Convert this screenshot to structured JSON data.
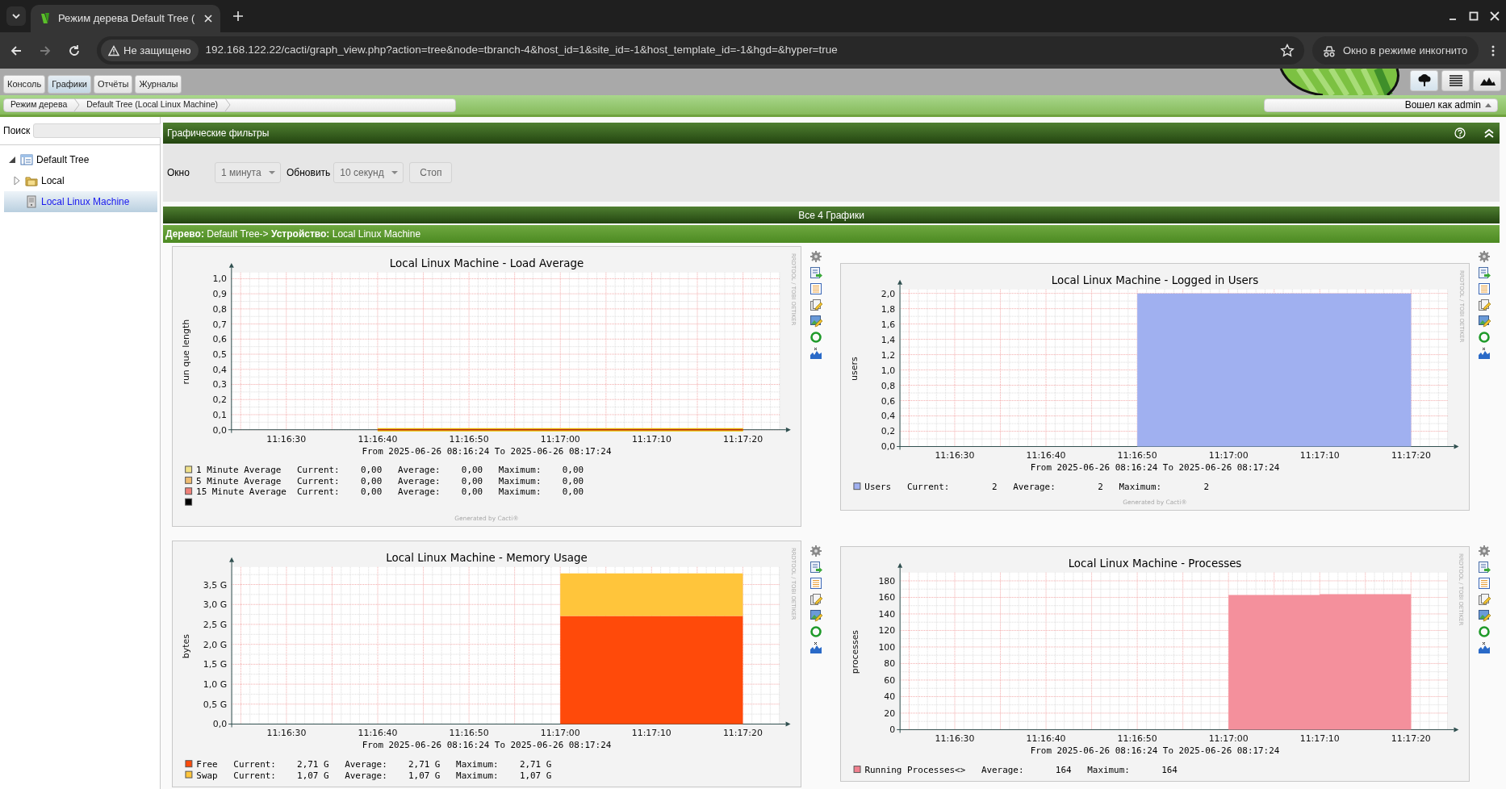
{
  "browser": {
    "tab_title": "Режим дерева Default Tree (",
    "security_label": "Не защищено",
    "url": "192.168.122.22/cacti/graph_view.php?action=tree&node=tbranch-4&host_id=1&site_id=-1&host_template_id=-1&hgd=&hyper=true",
    "profile_label": "Окно в режиме инкогнито",
    "can_go_forward": false
  },
  "nav_tabs": [
    {
      "label": "Консоль",
      "selected": false
    },
    {
      "label": "Графики",
      "selected": true
    },
    {
      "label": "Отчёты",
      "selected": false
    },
    {
      "label": "Журналы",
      "selected": false
    }
  ],
  "view_buttons": [
    {
      "kind": "tree",
      "selected": true
    },
    {
      "kind": "list",
      "selected": false
    },
    {
      "kind": "preview",
      "selected": false
    }
  ],
  "breadcrumbs": [
    "Режим дерева",
    "Default Tree (Local Linux Machine)"
  ],
  "user_menu": "Вошел как admin",
  "sidebar": {
    "search_label": "Поиск",
    "tree": [
      {
        "label": "Default Tree",
        "kind": "tree",
        "expanded": true,
        "selected": false,
        "children": [
          {
            "label": "Local",
            "kind": "site",
            "expanded": false,
            "selected": false
          },
          {
            "label": "Local Linux Machine",
            "kind": "device",
            "selected": true
          }
        ]
      }
    ]
  },
  "filters": {
    "title": "Графические фильтры",
    "fields": [
      {
        "label": "Окно",
        "value": "1 минута"
      },
      {
        "label": "Обновить",
        "value": "10 секунд"
      }
    ],
    "button": "Стоп"
  },
  "graphs_header": "Все 4 Графики",
  "path": "**Дерево:** Default Tree-> **Устройство:** Local Linux Machine",
  "graphs": [
    {
      "chart_data": {
        "type": "line",
        "title": "Local Linux Machine - Load Average",
        "ylabel": "run que length",
        "categories": [
          null,
          null,
          null,
          null,
          null,
          null,
          "11:16:30",
          null,
          null,
          null,
          null,
          null,
          null,
          null,
          null,
          null,
          "11:16:40",
          null,
          null,
          null,
          null,
          null,
          null,
          null,
          null,
          null,
          "11:16:50",
          null,
          null,
          null,
          null,
          null,
          null,
          null,
          null,
          null,
          "11:17:00",
          null,
          null,
          null,
          null,
          null,
          null,
          null,
          null,
          null,
          "11:17:10",
          null,
          null,
          null,
          null,
          null,
          null,
          null,
          null,
          null,
          "11:17:20",
          null,
          null,
          null,
          null
        ],
        "series": [
          {
            "name": "1 Minute Average",
            "color": "#eacc00",
            "values": [
              null,
              null,
              null,
              null,
              null,
              null,
              null,
              null,
              null,
              null,
              null,
              null,
              null,
              null,
              null,
              null,
              0,
              0,
              0,
              0,
              0,
              0,
              0,
              0,
              0,
              0,
              0,
              0,
              0,
              0,
              0,
              0,
              0,
              0,
              0,
              0,
              0,
              0,
              0,
              0,
              0,
              0,
              0,
              0,
              0,
              0,
              0,
              0,
              0,
              0,
              0,
              0,
              0,
              0,
              0,
              0,
              0,
              null,
              null,
              null,
              null
            ]
          },
          {
            "name": "5 Minute Average",
            "color": "#ea8f00",
            "values": [
              null,
              null,
              null,
              null,
              null,
              null,
              null,
              null,
              null,
              null,
              null,
              null,
              null,
              null,
              null,
              null,
              0,
              0,
              0,
              0,
              0,
              0,
              0,
              0,
              0,
              0,
              0,
              0,
              0,
              0,
              0,
              0,
              0,
              0,
              0,
              0,
              0,
              0,
              0,
              0,
              0,
              0,
              0,
              0,
              0,
              0,
              0,
              0,
              0,
              0,
              0,
              0,
              0,
              0,
              0,
              0,
              0,
              null,
              null,
              null,
              null
            ]
          },
          {
            "name": "15 Minute Average",
            "color": "#b03020",
            "values": [
              null,
              null,
              null,
              null,
              null,
              null,
              null,
              null,
              null,
              null,
              null,
              null,
              null,
              null,
              null,
              null,
              0,
              0,
              0,
              0,
              0,
              0,
              0,
              0,
              0,
              0,
              0,
              0,
              0,
              0,
              0,
              0,
              0,
              0,
              0,
              0,
              0,
              0,
              0,
              0,
              0,
              0,
              0,
              0,
              0,
              0,
              0,
              0,
              0,
              0,
              0,
              0,
              0,
              0,
              0,
              0,
              0,
              null,
              null,
              null,
              null
            ]
          }
        ],
        "ylim": [
          0,
          1.03
        ],
        "grid": true,
        "yticks": [
          {
            "value": 0,
            "label": "0,0"
          },
          {
            "value": 0.1,
            "label": "0,1"
          },
          {
            "value": 0.2,
            "label": "0,2"
          },
          {
            "value": 0.3,
            "label": "0,3"
          },
          {
            "value": 0.4,
            "label": "0,4"
          },
          {
            "value": 0.5,
            "label": "0,5"
          },
          {
            "value": 0.6,
            "label": "0,6"
          },
          {
            "value": 0.7,
            "label": "0,7"
          },
          {
            "value": 0.8,
            "label": "0,8"
          },
          {
            "value": 0.9,
            "label": "0,9"
          },
          {
            "value": 1.0,
            "label": "1,0"
          }
        ]
      },
      "time_range": "From 2025-06-26 08:16:24 To 2025-06-26 08:17:24",
      "legend": [
        {
          "color": "#efe08a",
          "stats": "   Current:    0,00   Average:    0,00   Maximum:    0,00"
        },
        {
          "color": "#eebc72",
          "stats": "   Current:    0,00   Average:    0,00   Maximum:    0,00"
        },
        {
          "color": "#f08078",
          "stats": "  Current:    0,00   Average:    0,00   Maximum:    0,00"
        },
        {
          "color": "#000000"
        }
      ],
      "side_label": "RRDTOOL / TOBI OETIKER",
      "footer": "Generated by Cacti®"
    },
    {
      "chart_data": {
        "type": "area",
        "title": "Local Linux Machine - Logged in Users",
        "ylabel": "users",
        "categories": [
          null,
          null,
          null,
          null,
          null,
          null,
          "11:16:30",
          null,
          null,
          null,
          null,
          null,
          null,
          null,
          null,
          null,
          "11:16:40",
          null,
          null,
          null,
          null,
          null,
          null,
          null,
          null,
          null,
          "11:16:50",
          null,
          null,
          null,
          null,
          null,
          null,
          null,
          null,
          null,
          "11:17:00",
          null,
          null,
          null,
          null,
          null,
          null,
          null,
          null,
          null,
          "11:17:10",
          null,
          null,
          null,
          null,
          null,
          null,
          null,
          null,
          null,
          "11:17:20",
          null,
          null,
          null,
          null
        ],
        "series": [
          {
            "name": "Users",
            "color": "#a0b0f0",
            "values": [
              null,
              null,
              null,
              null,
              null,
              null,
              null,
              null,
              null,
              null,
              null,
              null,
              null,
              null,
              null,
              null,
              null,
              null,
              null,
              null,
              null,
              null,
              null,
              null,
              null,
              null,
              2,
              2,
              2,
              2,
              2,
              2,
              2,
              2,
              2,
              2,
              2,
              2,
              2,
              2,
              2,
              2,
              2,
              2,
              2,
              2,
              2,
              2,
              2,
              2,
              2,
              2,
              2,
              2,
              2,
              2,
              2,
              null,
              null,
              null,
              null
            ]
          }
        ],
        "ylim": [
          0,
          2.03
        ],
        "grid": true,
        "yticks": [
          {
            "value": 0,
            "label": "0,0"
          },
          {
            "value": 0.2,
            "label": "0,2"
          },
          {
            "value": 0.4,
            "label": "0,4"
          },
          {
            "value": 0.6,
            "label": "0,6"
          },
          {
            "value": 0.8,
            "label": "0,8"
          },
          {
            "value": 1.0,
            "label": "1,0"
          },
          {
            "value": 1.2,
            "label": "1,2"
          },
          {
            "value": 1.4,
            "label": "1,4"
          },
          {
            "value": 1.6,
            "label": "1,6"
          },
          {
            "value": 1.8,
            "label": "1,8"
          },
          {
            "value": 2.0,
            "label": "2,0"
          }
        ]
      },
      "time_range": "From 2025-06-26 08:16:24 To 2025-06-26 08:17:24",
      "legend": [
        {
          "color": "#a0b0f0",
          "stats": "   Current:        2   Average:        2   Maximum:        2"
        }
      ],
      "side_label": "RRDTOOL / TOBI OETIKER",
      "footer": "Generated by Cacti®"
    },
    {
      "chart_data": {
        "type": "area",
        "stacked": true,
        "title": "Local Linux Machine - Memory Usage",
        "ylabel": "bytes",
        "categories": [
          null,
          null,
          null,
          null,
          null,
          null,
          "11:16:30",
          null,
          null,
          null,
          null,
          null,
          null,
          null,
          null,
          null,
          "11:16:40",
          null,
          null,
          null,
          null,
          null,
          null,
          null,
          null,
          null,
          "11:16:50",
          null,
          null,
          null,
          null,
          null,
          null,
          null,
          null,
          null,
          "11:17:00",
          null,
          null,
          null,
          null,
          null,
          null,
          null,
          null,
          null,
          "11:17:10",
          null,
          null,
          null,
          null,
          null,
          null,
          null,
          null,
          null,
          "11:17:20",
          null,
          null,
          null,
          null
        ],
        "series": [
          {
            "name": "Free",
            "color": "#ff4a0a",
            "values": [
              null,
              null,
              null,
              null,
              null,
              null,
              null,
              null,
              null,
              null,
              null,
              null,
              null,
              null,
              null,
              null,
              null,
              null,
              null,
              null,
              null,
              null,
              null,
              null,
              null,
              null,
              null,
              null,
              null,
              null,
              null,
              null,
              null,
              null,
              null,
              null,
              2.71,
              2.71,
              2.71,
              2.71,
              2.71,
              2.71,
              2.71,
              2.71,
              2.71,
              2.71,
              2.71,
              2.71,
              2.71,
              2.71,
              2.71,
              2.71,
              2.71,
              2.71,
              2.71,
              2.71,
              2.71,
              null,
              null,
              null,
              null
            ]
          },
          {
            "name": "Swap",
            "color": "#ffc53b",
            "values": [
              null,
              null,
              null,
              null,
              null,
              null,
              null,
              null,
              null,
              null,
              null,
              null,
              null,
              null,
              null,
              null,
              null,
              null,
              null,
              null,
              null,
              null,
              null,
              null,
              null,
              null,
              null,
              null,
              null,
              null,
              null,
              null,
              null,
              null,
              null,
              null,
              1.07,
              1.07,
              1.07,
              1.07,
              1.07,
              1.07,
              1.07,
              1.07,
              1.07,
              1.07,
              1.07,
              1.07,
              1.07,
              1.07,
              1.07,
              1.07,
              1.07,
              1.07,
              1.07,
              1.07,
              1.07,
              null,
              null,
              null,
              null
            ]
          }
        ],
        "ylim": [
          0,
          3.9
        ],
        "grid": true,
        "yticks": [
          {
            "value": 0,
            "label": "0,0"
          },
          {
            "value": 0.5,
            "label": "0,5 G"
          },
          {
            "value": 1.0,
            "label": "1,0 G"
          },
          {
            "value": 1.5,
            "label": "1,5 G"
          },
          {
            "value": 2.0,
            "label": "2,0 G"
          },
          {
            "value": 2.5,
            "label": "2,5 G"
          },
          {
            "value": 3.0,
            "label": "3,0 G"
          },
          {
            "value": 3.5,
            "label": "3,5 G"
          }
        ]
      },
      "time_range": "From 2025-06-26 08:16:24 To 2025-06-26 08:17:24",
      "legend": [
        {
          "color": "#ff4a0a",
          "stats": "   Current:    2,71 G   Average:    2,71 G   Maximum:    2,71 G"
        },
        {
          "color": "#ffc53b",
          "stats": "   Current:    1,07 G   Average:    1,07 G   Maximum:    1,07 G"
        }
      ],
      "side_label": "RRDTOOL / TOBI OETIKER"
    },
    {
      "chart_data": {
        "type": "area",
        "title": "Local Linux Machine - Processes",
        "ylabel": "processes",
        "categories": [
          null,
          null,
          null,
          null,
          null,
          null,
          "11:16:30",
          null,
          null,
          null,
          null,
          null,
          null,
          null,
          null,
          null,
          "11:16:40",
          null,
          null,
          null,
          null,
          null,
          null,
          null,
          null,
          null,
          "11:16:50",
          null,
          null,
          null,
          null,
          null,
          null,
          null,
          null,
          null,
          "11:17:00",
          null,
          null,
          null,
          null,
          null,
          null,
          null,
          null,
          null,
          "11:17:10",
          null,
          null,
          null,
          null,
          null,
          null,
          null,
          null,
          null,
          "11:17:20",
          null,
          null,
          null,
          null
        ],
        "series": [
          {
            "name": "Running Processes<>",
            "color": "#f4909c",
            "values": [
              null,
              null,
              null,
              null,
              null,
              null,
              null,
              null,
              null,
              null,
              null,
              null,
              null,
              null,
              null,
              null,
              null,
              null,
              null,
              null,
              null,
              null,
              null,
              null,
              null,
              null,
              null,
              null,
              null,
              null,
              null,
              null,
              null,
              null,
              null,
              null,
              163,
              163,
              163,
              163,
              163,
              163,
              163,
              163,
              163,
              163,
              164,
              164,
              164,
              164,
              164,
              164,
              164,
              164,
              164,
              164,
              164,
              null,
              null,
              null,
              null
            ]
          }
        ],
        "ylim": [
          0,
          188
        ],
        "grid": true,
        "yticks": [
          {
            "value": 0,
            "label": "0"
          },
          {
            "value": 20,
            "label": "20"
          },
          {
            "value": 40,
            "label": "40"
          },
          {
            "value": 60,
            "label": "60"
          },
          {
            "value": 80,
            "label": "80"
          },
          {
            "value": 100,
            "label": "100"
          },
          {
            "value": 120,
            "label": "120"
          },
          {
            "value": 140,
            "label": "140"
          },
          {
            "value": 160,
            "label": "160"
          },
          {
            "value": 180,
            "label": "180"
          }
        ]
      },
      "time_range": "From 2025-06-26 08:16:24 To 2025-06-26 08:17:24",
      "legend": [
        {
          "color": "#f0808e",
          "stats": "   Average:      164   Maximum:      164"
        }
      ],
      "side_label": "RRDTOOL / TOBI OETIKER"
    }
  ]
}
